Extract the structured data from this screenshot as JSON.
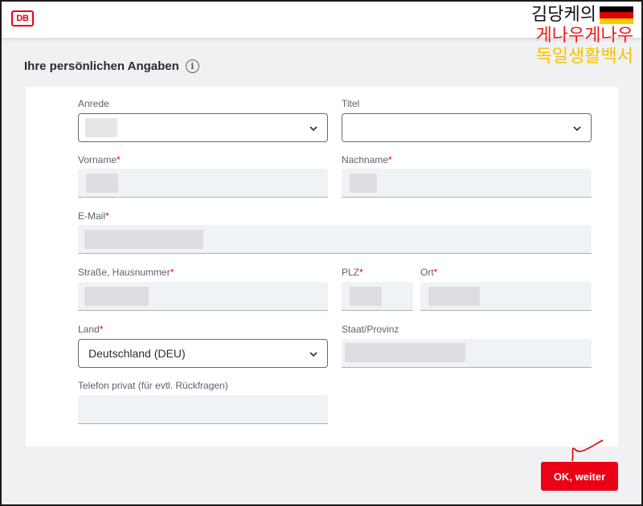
{
  "header": {
    "logo_text": "DB",
    "overlay_line1": "김당케의",
    "overlay_line2": "게나우게나우",
    "overlay_line3": "독일생활백서",
    "flag_colors": [
      "#000000",
      "#dd0000",
      "#ffce00"
    ]
  },
  "section": {
    "title": "Ihre persönlichen Angaben",
    "info_icon": "i"
  },
  "form": {
    "anrede": {
      "label": "Anrede",
      "value": ""
    },
    "titel": {
      "label": "Titel",
      "value": ""
    },
    "vorname": {
      "label": "Vorname",
      "required": "*"
    },
    "nachname": {
      "label": "Nachname",
      "required": "*"
    },
    "email": {
      "label": "E-Mail",
      "required": "*"
    },
    "strasse": {
      "label": "Straße, Hausnummer",
      "required": "*"
    },
    "plz": {
      "label": "PLZ",
      "required": "*"
    },
    "ort": {
      "label": "Ort",
      "required": "*"
    },
    "land": {
      "label": "Land",
      "required": "*",
      "value": "Deutschland (DEU)"
    },
    "staat": {
      "label": "Staat/Provinz"
    },
    "telefon": {
      "label": "Telefon privat (für evtl. Rückfragen)"
    }
  },
  "actions": {
    "submit_label": "OK, weiter"
  },
  "colors": {
    "brand_red": "#ec0016",
    "annotation_red": "#e00000"
  }
}
